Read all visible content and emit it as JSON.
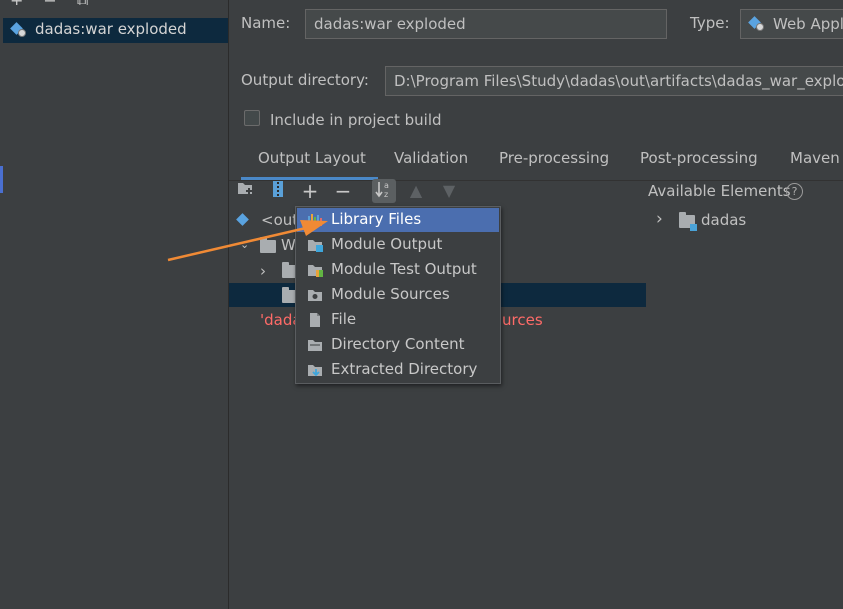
{
  "left_panel": {
    "artifact_item": "dadas:war exploded"
  },
  "form": {
    "name_label": "Name:",
    "name_value": "dadas:war exploded",
    "type_label": "Type:",
    "type_value": "Web Appl",
    "output_dir_label": "Output directory:",
    "output_dir_value": "D:\\Program Files\\Study\\dadas\\out\\artifacts\\dadas_war_explod",
    "include_label": "Include in project build",
    "include_checked": false
  },
  "tabs": [
    "Output Layout",
    "Validation",
    "Pre-processing",
    "Post-processing",
    "Maven"
  ],
  "tree": {
    "root_label": "<out",
    "child_label": "W",
    "error_prefix": "'dada",
    "error_suffix": "urces"
  },
  "available": {
    "title": "Available Elements",
    "help": "?",
    "item": "dadas"
  },
  "popup": {
    "items": [
      {
        "label": "Library Files",
        "icon": "library-icon"
      },
      {
        "label": "Module Output",
        "icon": "module-output-icon"
      },
      {
        "label": "Module Test Output",
        "icon": "module-test-output-icon"
      },
      {
        "label": "Module Sources",
        "icon": "module-sources-icon"
      },
      {
        "label": "File",
        "icon": "file-icon"
      },
      {
        "label": "Directory Content",
        "icon": "directory-content-icon"
      },
      {
        "label": "Extracted Directory",
        "icon": "extracted-directory-icon"
      }
    ],
    "selected": "Library Files"
  },
  "colors": {
    "background": "#3c3f41",
    "selection": "#0d293e",
    "menu_selection": "#4b6eaf",
    "accent_tab": "#4a88c7",
    "error": "#ff6b68",
    "arrow": "#f08a35"
  }
}
